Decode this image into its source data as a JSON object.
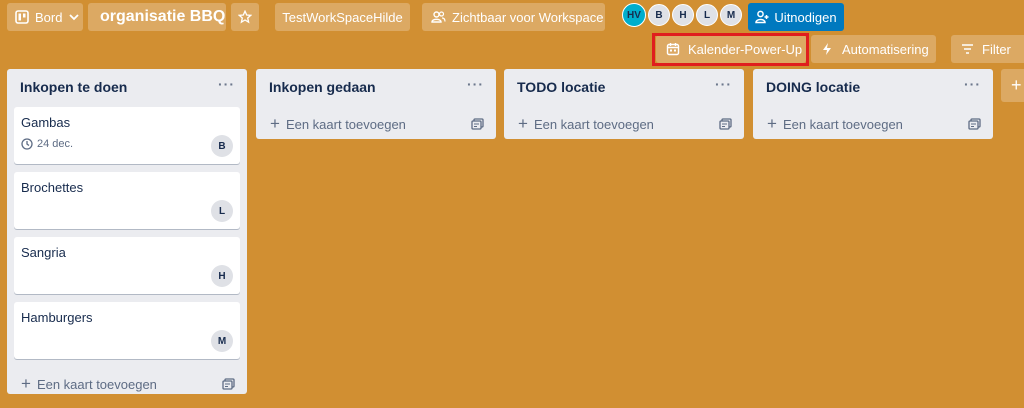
{
  "header": {
    "board_menu": "Bord",
    "board_title": "organisatie BBQ",
    "workspace": "TestWorkSpaceHilde",
    "visibility": "Zichtbaar voor Workspace",
    "members": [
      "HV",
      "B",
      "H",
      "L",
      "M"
    ],
    "invite": "Uitnodigen"
  },
  "toolbar": {
    "calendar": "Kalender-Power-Up",
    "automation": "Automatisering",
    "filter": "Filter"
  },
  "lists": [
    {
      "title": "Inkopen te doen",
      "menu": "···",
      "cards": [
        {
          "title": "Gambas",
          "due": "24 dec.",
          "member": "B"
        },
        {
          "title": "Brochettes",
          "member": "L"
        },
        {
          "title": "Sangria",
          "member": "H"
        },
        {
          "title": "Hamburgers",
          "member": "M"
        }
      ],
      "add_card": "Een kaart toevoegen"
    },
    {
      "title": "Inkopen gedaan",
      "menu": "···",
      "add_card": "Een kaart toevoegen"
    },
    {
      "title": "TODO locatie",
      "menu": "···",
      "add_card": "Een kaart toevoegen"
    },
    {
      "title": "DOING locatie",
      "menu": "···",
      "add_card": "Een kaart toevoegen"
    }
  ],
  "icons": {
    "board": "board-icon",
    "chevron": "chevron-down-icon",
    "star": "star-icon",
    "visibility": "people-icon",
    "invite": "add-person-icon",
    "calendar": "calendar-icon",
    "automation": "lightning-icon",
    "filter": "filter-icon",
    "clock": "clock-icon",
    "template": "card-template-icon"
  },
  "colors": {
    "background": "#d18f32",
    "invite_button": "#0079bf",
    "highlight_box": "#e01e1e"
  }
}
